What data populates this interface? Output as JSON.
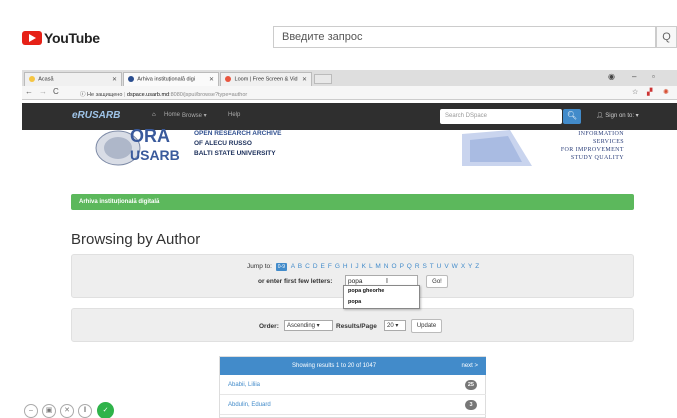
{
  "youtube": {
    "logo_word": "YouTube",
    "search_placeholder": "Введите запрос",
    "search_icon": "Q"
  },
  "browser": {
    "tabs": [
      {
        "label": "Acasă"
      },
      {
        "label": "Arhiva instituțională digi"
      },
      {
        "label": "Loom | Free Screen & Vid"
      }
    ],
    "security_label": "Не защищено",
    "url_host": "dspace.usarb.md",
    "url_path": ":8080/jspui/browse?type=author"
  },
  "dspace_nav": {
    "logo": "eRUSARB",
    "home": "Home",
    "browse": "Browse ▾",
    "help": "Help",
    "search_placeholder": "Search DSpace",
    "sign_on": "Sign on to: ▾"
  },
  "banner": {
    "ora_letters": "ORA",
    "usarb_letters": "USARB",
    "line1": "OPEN RESEARCH ARCHIVE",
    "line2": "OF ALECU RUSSO",
    "line3": "BALTI STATE UNIVERSITY",
    "iaqa_line1": "INFORMATION",
    "iaqa_line2": "SERVICES",
    "iaqa_line3": "FOR IMPROVEMENT",
    "iaqa_line4": "STUDY QUALITY"
  },
  "breadcrumb": "Arhiva instituțională digitală",
  "page_title": "Browsing by Author",
  "jump": {
    "label": "Jump to:",
    "zero_nine": "0-9",
    "letters": "A B C D E F G H I J K L M N O P Q R S T U V W X Y Z",
    "enter_label": "or enter first few letters:",
    "input_value": "popa",
    "go": "Go!",
    "suggestions": [
      "popa gheorhe",
      "popa"
    ]
  },
  "order": {
    "order_label": "Order:",
    "order_value": "Ascending ▾",
    "rpp_label": "Results/Page",
    "rpp_value": "20 ▾",
    "update": "Update"
  },
  "results": {
    "showing": "Showing results 1 to 20 of 1047",
    "next": "next >",
    "rows": [
      {
        "name": "Ababii, Liliia",
        "count": "25"
      },
      {
        "name": "Abdulin, Eduard",
        "count": "3"
      }
    ]
  }
}
